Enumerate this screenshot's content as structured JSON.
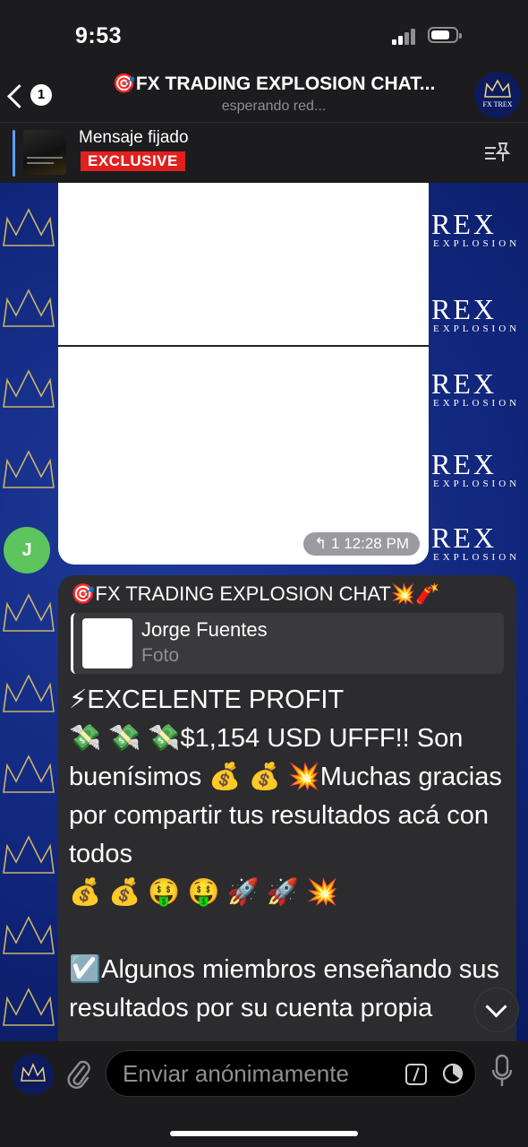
{
  "status": {
    "time": "9:53"
  },
  "header": {
    "back_count": "1",
    "title": "🎯FX TRADING EXPLOSION CHAT...",
    "subtitle": "esperando red...",
    "avatar_label": "FX TREX"
  },
  "pinned": {
    "title": "Mensaje fijado",
    "badge": "EXCLUSIVE"
  },
  "background": {
    "brand_big": "REX",
    "brand_small": "EXPLOSION"
  },
  "image_message": {
    "meta": "↰ 1 12:28 PM",
    "sender_initial": "J"
  },
  "text_message": {
    "forwarded_from": "🎯FX TRADING EXPLOSION CHAT💥🧨",
    "reply_name": "Jorge Fuentes",
    "reply_sub": "Foto",
    "lines": [
      "⚡EXCELENTE PROFIT",
      "💸 💸 💸$1,154 USD UFFF!! Son buenísimos 💰 💰 💥Muchas gracias por compartir tus resultados acá con todos",
      "💰 💰 🤑 🤑 🚀 🚀 💥",
      "",
      "☑️Algunos miembros enseñando sus resultados por su cuenta propia"
    ]
  },
  "input": {
    "placeholder": "Enviar anónimamente"
  },
  "colors": {
    "badge_red": "#e0201f",
    "chat_blue": "#10257a",
    "avatar_green": "#5ec45e",
    "bubble_dark": "#2c2c2e"
  }
}
